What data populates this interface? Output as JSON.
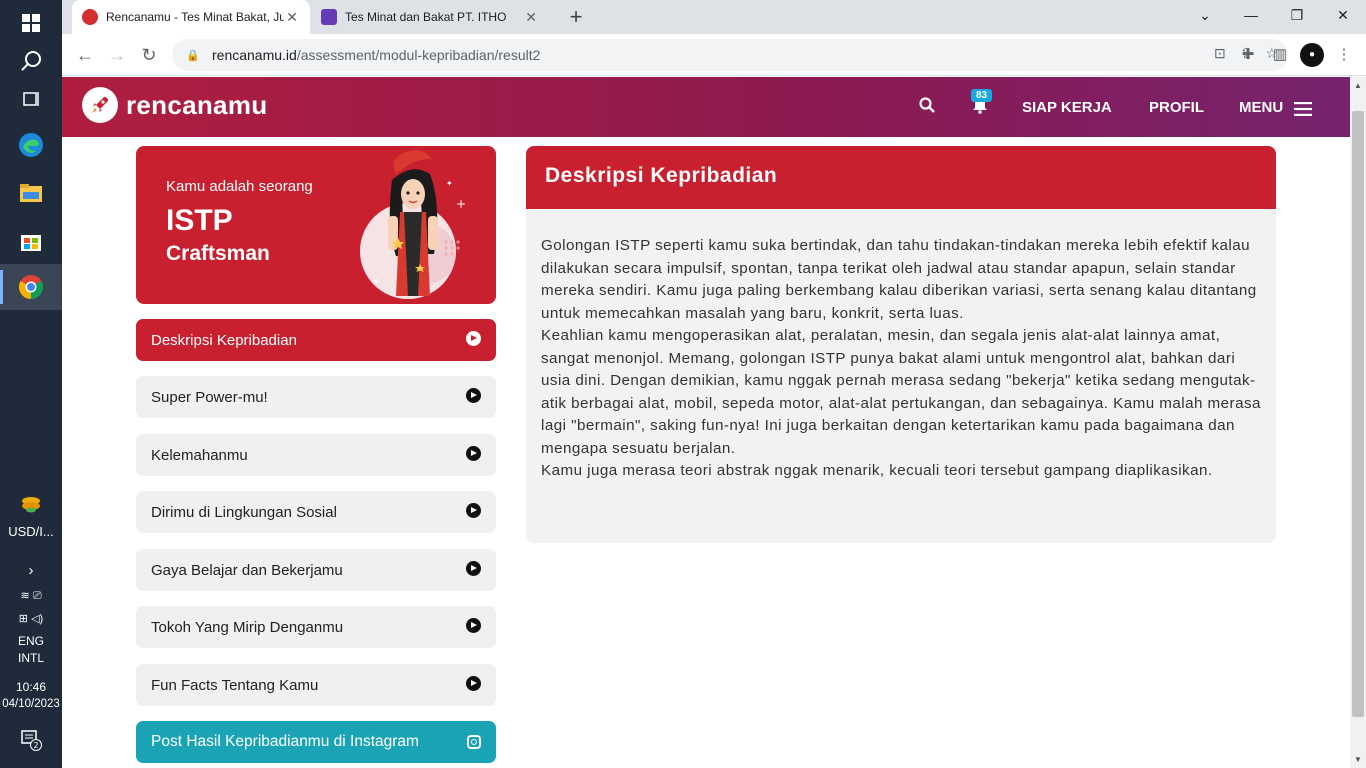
{
  "taskbar": {
    "currency": "USD/I...",
    "lang1": "ENG",
    "lang2": "INTL",
    "time": "10:46",
    "date": "04/10/2023",
    "notif_count": "2"
  },
  "browser": {
    "tabs": [
      {
        "title": "Rencanamu - Tes Minat Bakat, Ju",
        "active": true
      },
      {
        "title": "Tes Minat dan Bakat PT. ITHO",
        "active": false
      }
    ],
    "url_host": "rencanamu.id",
    "url_path": "/assessment/modul-kepribadian/result2"
  },
  "site": {
    "logo": "rencanamu",
    "badge": "83",
    "nav": [
      "SIAP KERJA",
      "PROFIL",
      "MENU"
    ]
  },
  "hero": {
    "subtitle": "Kamu adalah seorang",
    "type": "ISTP",
    "name": "Craftsman"
  },
  "menu": [
    {
      "label": "Deskripsi Kepribadian",
      "active": true
    },
    {
      "label": "Super Power-mu!"
    },
    {
      "label": "Kelemahanmu"
    },
    {
      "label": "Dirimu di Lingkungan Sosial"
    },
    {
      "label": "Gaya Belajar dan Bekerjamu"
    },
    {
      "label": "Tokoh Yang Mirip Denganmu"
    },
    {
      "label": "Fun Facts Tentang Kamu"
    },
    {
      "label": "Post Hasil Kepribadianmu di Instagram"
    }
  ],
  "description": {
    "title": "Deskripsi Kepribadian",
    "paragraphs": [
      "Golongan ISTP seperti kamu suka bertindak, dan tahu tindakan-tindakan mereka lebih efektif kalau dilakukan secara impulsif, spontan, tanpa terikat oleh jadwal atau standar apapun, selain standar mereka sendiri. Kamu juga paling berkembang kalau diberikan variasi, serta senang kalau ditantang untuk memecahkan masalah yang baru, konkrit, serta luas.",
      "Keahlian kamu mengoperasikan alat, peralatan, mesin, dan segala jenis alat-alat lainnya amat, sangat menonjol. Memang, golongan ISTP punya bakat alami untuk mengontrol alat, bahkan dari usia dini. Dengan demikian, kamu nggak pernah merasa sedang \"bekerja\" ketika sedang mengutak-atik berbagai alat, mobil, sepeda motor, alat-alat pertukangan, dan sebagainya. Kamu malah merasa lagi \"bermain\", saking fun-nya! Ini juga berkaitan dengan ketertarikan kamu pada bagaimana dan mengapa sesuatu berjalan.",
      "Kamu juga merasa teori abstrak nggak menarik, kecuali teori tersebut gampang diaplikasikan."
    ]
  },
  "colors": {
    "primary": "#c8202f",
    "instagram": "#1aa3b5"
  }
}
